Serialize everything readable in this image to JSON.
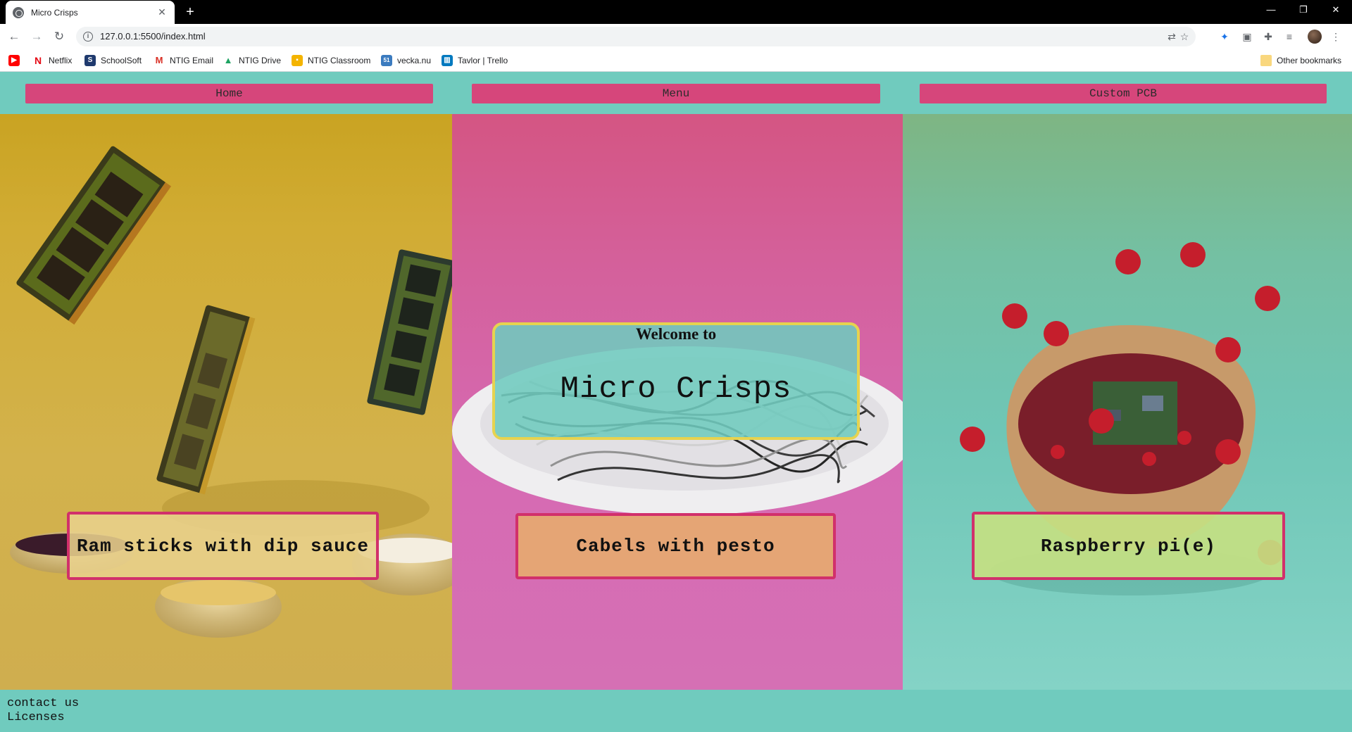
{
  "browser": {
    "tab_title": "Micro Crisps",
    "url": "127.0.0.1:5500/index.html",
    "bookmarks": [
      {
        "label": "",
        "icon": "youtube-icon",
        "color": "#ff0000"
      },
      {
        "label": "Netflix",
        "icon": "netflix-icon",
        "color": "#e50914"
      },
      {
        "label": "SchoolSoft",
        "icon": "schoolsoft-icon",
        "color": "#1f3a6e"
      },
      {
        "label": "NTIG Email",
        "icon": "gmail-icon",
        "color": "#d93025"
      },
      {
        "label": "NTIG Drive",
        "icon": "drive-icon",
        "color": "#1ea362"
      },
      {
        "label": "NTIG Classroom",
        "icon": "classroom-icon",
        "color": "#f4b400"
      },
      {
        "label": "vecka.nu",
        "icon": "calendar-icon",
        "color": "#3b7bbf"
      },
      {
        "label": "Tavlor | Trello",
        "icon": "trello-icon",
        "color": "#0079bf"
      }
    ],
    "other_bookmarks": "Other bookmarks"
  },
  "nav": {
    "home": "Home",
    "menu": "Menu",
    "custom_pcb": "Custom PCB"
  },
  "hero": {
    "subtitle": "Welcome to",
    "title": "Micro Crisps"
  },
  "dishes": [
    {
      "label": "Ram sticks with dip sauce"
    },
    {
      "label": "Cabels with pesto"
    },
    {
      "label": "Raspberry pi(e)"
    }
  ],
  "footer": {
    "contact": "contact us",
    "licenses": "Licenses"
  },
  "colors": {
    "page_bg": "#70cbbe",
    "nav_button": "#d6467b",
    "card_border": "#d1306b",
    "hero_border": "#e6d34f",
    "panel_yellow": "#d1ac34",
    "panel_pink": "#d66ab3",
    "panel_teal": "#6fc6b6"
  }
}
